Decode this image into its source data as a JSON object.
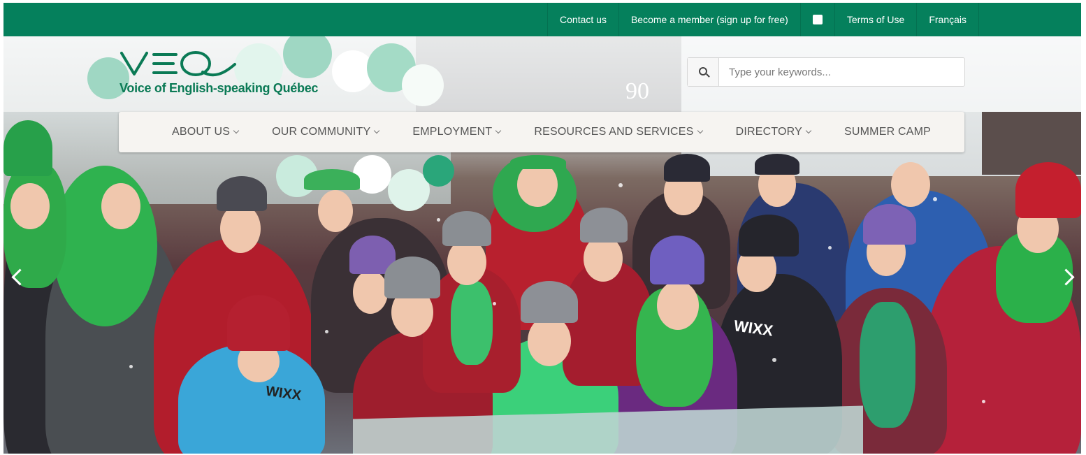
{
  "topbar": {
    "links": [
      {
        "label": "Contact us"
      },
      {
        "label": "Become a member (sign up for free)"
      },
      {
        "icon": "facebook-icon"
      },
      {
        "label": "Terms of Use"
      },
      {
        "label": "Français"
      }
    ],
    "color": "#05805c"
  },
  "logo": {
    "mark": "VEQ",
    "text": "Voice of English-speaking Québec"
  },
  "search": {
    "icon": "search-icon",
    "placeholder": "Type your keywords...",
    "value": ""
  },
  "nav": {
    "items": [
      {
        "label": "ABOUT US",
        "dropdown": true
      },
      {
        "label": "OUR COMMUNITY",
        "dropdown": true
      },
      {
        "label": "EMPLOYMENT",
        "dropdown": true
      },
      {
        "label": "RESOURCES AND SERVICES",
        "dropdown": true
      },
      {
        "label": "DIRECTORY",
        "dropdown": true
      },
      {
        "label": "SUMMER CAMP",
        "dropdown": false
      }
    ]
  },
  "carousel": {
    "prev_icon": "chevron-left-icon",
    "next_icon": "chevron-right-icon",
    "slide_count": 6,
    "active_index": 3,
    "sign_number": "90",
    "shirt_text": "WIXX"
  }
}
